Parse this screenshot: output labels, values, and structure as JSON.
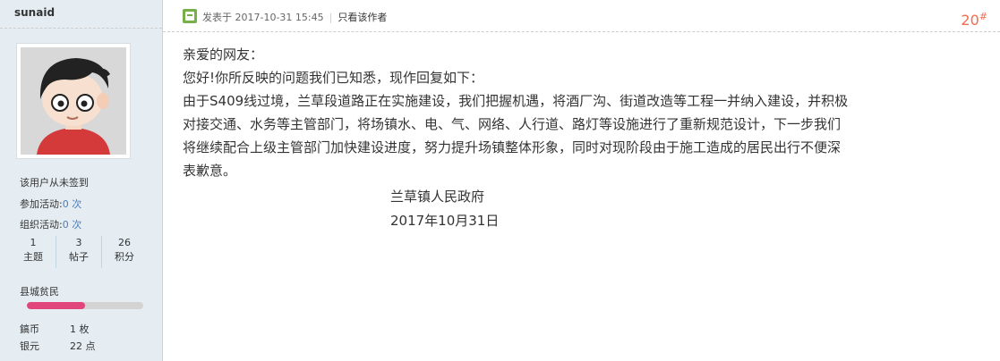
{
  "user": {
    "name": "sunaid",
    "signin_text": "该用户从未签到",
    "activities_joined_label": "参加活动:",
    "activities_joined_value": "0 次",
    "activities_organized_label": "组织活动:",
    "activities_organized_value": "0 次",
    "counts": [
      {
        "num": "1",
        "label": "主题"
      },
      {
        "num": "3",
        "label": "帖子"
      },
      {
        "num": "26",
        "label": "积分"
      }
    ],
    "rank": "县城贫民",
    "rank_progress": 0.5,
    "currencies": [
      {
        "name": "鎬币",
        "value": "1 枚"
      },
      {
        "name": "银元",
        "value": "22 点"
      }
    ]
  },
  "post": {
    "posted_label": "发表于 2017-10-31 15:45",
    "only_author": "只看该作者",
    "floor_number": "20",
    "floor_mark": "#",
    "greeting": "亲爱的网友：",
    "intro": "您好!你所反映的问题我们已知悉，现作回复如下：",
    "body_lines": [
      "由于S409线过境，兰草段道路正在实施建设，我们把握机遇，将酒厂沟、街道改造等工程一并纳入建设，并积极",
      "对接交通、水务等主管部门，将场镇水、电、气、网络、人行道、路灯等设施进行了重新规范设计，下一步我们",
      "将继续配合上级主管部门加快建设进度，努力提升场镇整体形象，同时对现阶段由于施工造成的居民出行不便深",
      "表歉意。"
    ],
    "signature_org": "兰草镇人民政府",
    "signature_date": "2017年10月31日"
  },
  "colors": {
    "sidebar_bg": "#e5edf2",
    "accent_link": "#4a7cbc",
    "floor_color": "#f26c4f",
    "rank_bar_fill": "#e0457b",
    "post_icon": "#77b049"
  }
}
